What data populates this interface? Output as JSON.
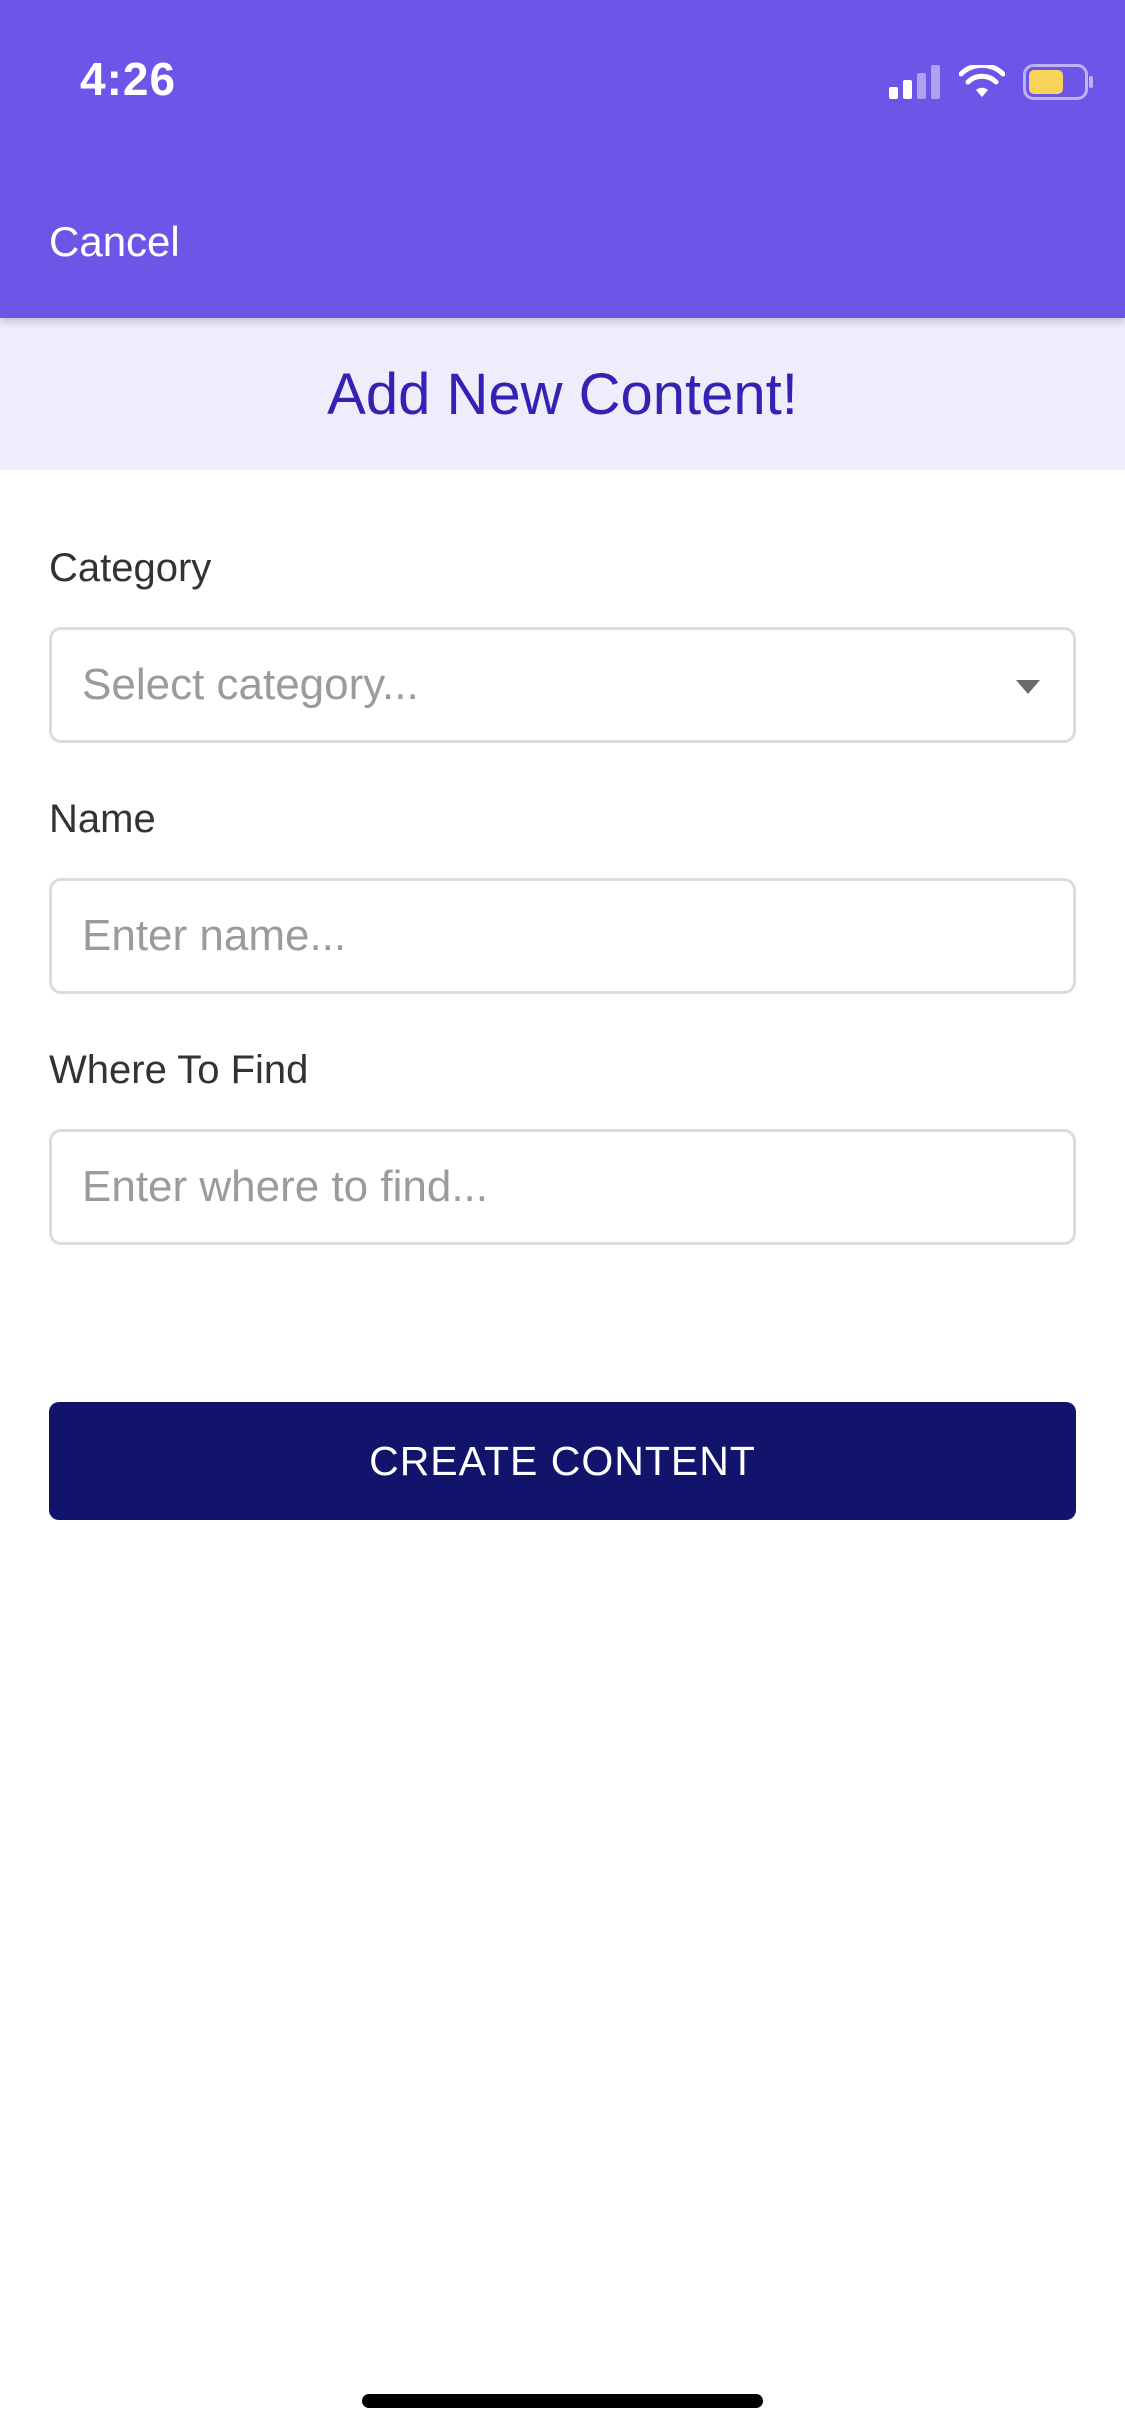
{
  "status_bar": {
    "time": "4:26",
    "battery_color": "#f7d358"
  },
  "nav": {
    "cancel_label": "Cancel",
    "background_color": "#6e55e8"
  },
  "page": {
    "title": "Add New Content!",
    "title_color": "#3322b3"
  },
  "form": {
    "category": {
      "label": "Category",
      "placeholder": "Select category..."
    },
    "name": {
      "label": "Name",
      "placeholder": "Enter name..."
    },
    "where_to_find": {
      "label": "Where To Find",
      "placeholder": "Enter where to find..."
    },
    "submit_label": "CREATE CONTENT",
    "submit_color": "#12146c"
  },
  "icons": {
    "signal": "cellular-signal-icon",
    "wifi": "wifi-icon",
    "battery": "battery-icon",
    "dropdown": "chevron-down-icon"
  }
}
